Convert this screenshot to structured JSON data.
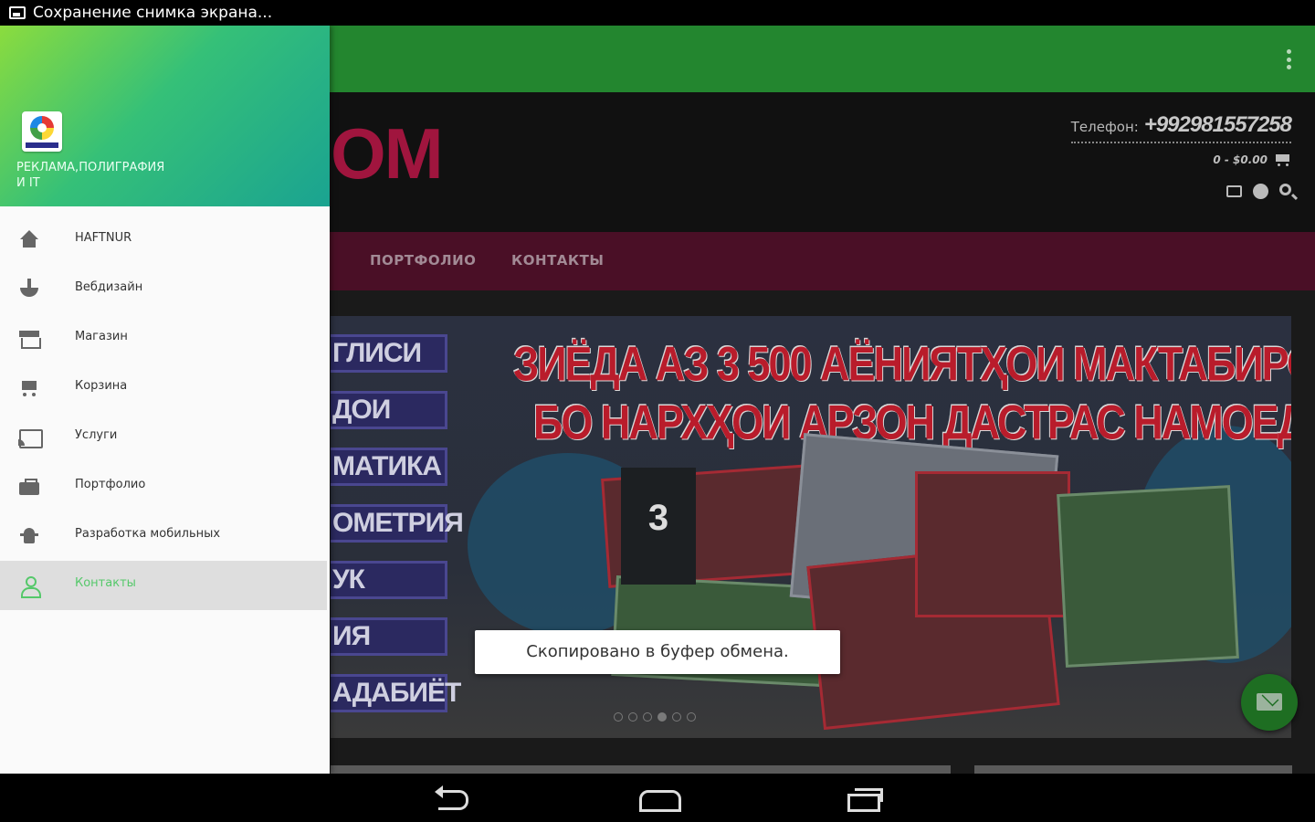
{
  "status_bar": {
    "text": "Сохранение снимка экрана..."
  },
  "website": {
    "logo_fragment": "ОМ",
    "phone_label": "Телефон:",
    "phone_number": "+992981557258",
    "cart_text": "0 - $0.00",
    "nav": [
      "ПОРТФОЛИО",
      "КОНТАКТЫ"
    ],
    "banner": {
      "headline_1": "ЗИЁДА АЗ 3 500 АЁНИЯТҲОИ МАКТАБИРО",
      "headline_2": "БО НАРХҲОИ АРЗОН ДАСТРАС НАМОЕД.",
      "subjects": [
        "ГЛИСИ",
        "ДОИ",
        "МАТИКА",
        "ОМЕТРИЯ",
        "УК",
        "ИЯ",
        "АДАБИЁТ"
      ],
      "card_number": "3"
    }
  },
  "toast": {
    "text": "Скопировано в буфер обмена."
  },
  "drawer": {
    "title": "РЕКЛАМА,ПОЛИГРАФИЯ И IT",
    "items": [
      {
        "label": "HAFTNUR",
        "icon": "home-icon"
      },
      {
        "label": "Вебдизайн",
        "icon": "web-design-icon"
      },
      {
        "label": "Магазин",
        "icon": "store-icon"
      },
      {
        "label": "Корзина",
        "icon": "cart-icon"
      },
      {
        "label": "Услуги",
        "icon": "cast-icon"
      },
      {
        "label": "Портфолио",
        "icon": "briefcase-icon"
      },
      {
        "label": "Разработка мобильных",
        "icon": "android-icon"
      },
      {
        "label": "Контакты",
        "icon": "person-icon",
        "active": true
      }
    ]
  },
  "colors": {
    "toolbar": "#23862f",
    "accent": "#55c86a",
    "fab": "#1e6e22"
  }
}
